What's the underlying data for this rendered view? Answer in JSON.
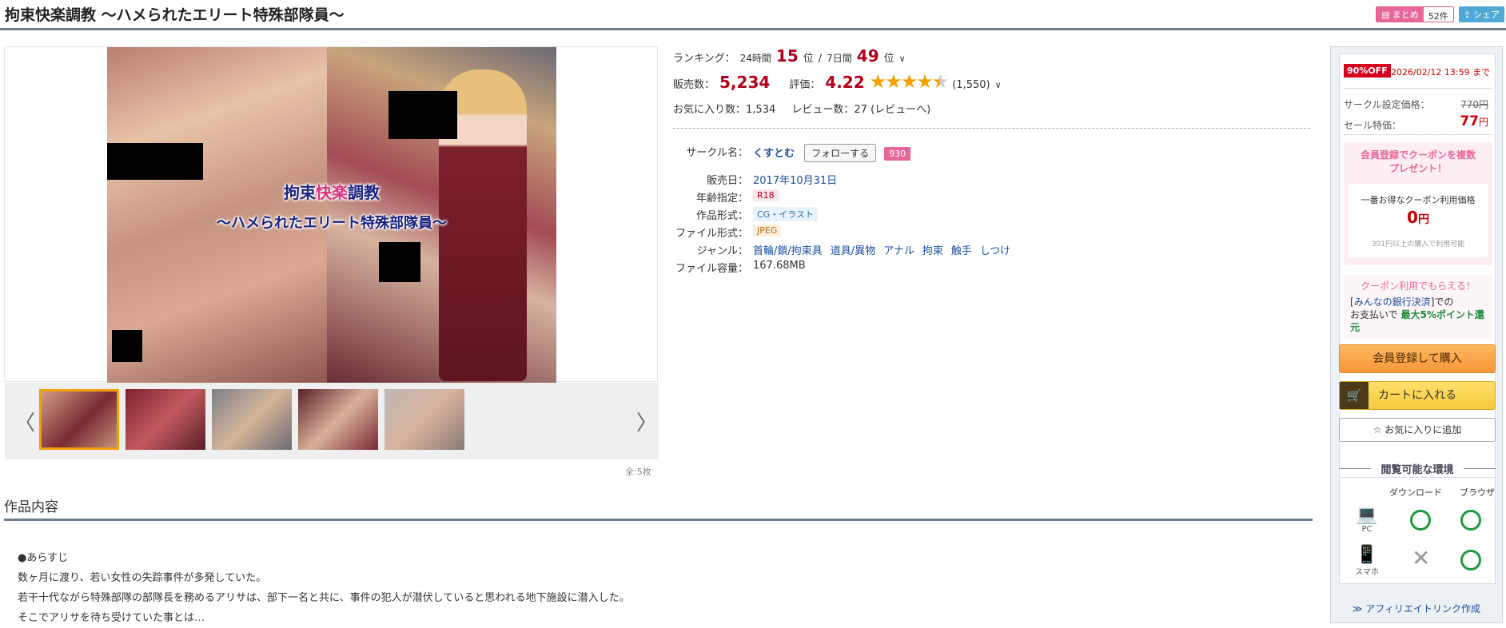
{
  "header": {
    "title": "拘束快楽調教 〜ハメられたエリート特殊部隊員〜",
    "matome_label": "まとめ",
    "matome_count": "52件",
    "share_label": "シェア"
  },
  "cover": {
    "title_line1_a": "拘束",
    "title_line1_b": "快楽",
    "title_line1_c": "調教",
    "title_line2": "〜ハメられたエリート特殊部隊員〜"
  },
  "gallery": {
    "total": "全:5枚"
  },
  "ranking": {
    "label": "ランキング：",
    "day_label": "24時間",
    "day_rank": "15",
    "unit": "位",
    "sep": "/",
    "week_label": "7日間",
    "week_rank": "49",
    "unit2": "位"
  },
  "sales": {
    "label": "販売数：",
    "value": "5,234",
    "rating_label": "評価：",
    "rating": "4.22",
    "stars_full": "★★★★",
    "stars_half": "★",
    "rating_count": "(1,550)",
    "fav_label": "お気に入り数：",
    "fav_value": "1,534",
    "review_label": "レビュー数：",
    "review_value": "27",
    "review_link": "(レビューへ)"
  },
  "specs": {
    "circle_key": "サークル名：",
    "circle": "くすとむ",
    "follow": "フォローする",
    "follow_count": "930",
    "date_key": "販売日：",
    "date": "2017年10月31日",
    "age_key": "年齢指定：",
    "age": "R18",
    "form_key": "作品形式：",
    "form": "CG・イラスト",
    "file_key": "ファイル形式：",
    "file": "JPEG",
    "genre_key": "ジャンル：",
    "genres": [
      "首輪/鎖/拘束具",
      "道具/異物",
      "アナル",
      "拘束",
      "触手",
      "しつけ"
    ],
    "size_key": "ファイル容量：",
    "size": "167.68MB"
  },
  "section": {
    "title": "作品内容",
    "lines": [
      "●あらすじ",
      "数ヶ月に渡り、若い女性の失踪事件が多発していた。",
      "若干十代ながら特殊部隊の部隊長を務めるアリサは、部下一名と共に、事件の犯人が潜伏していると思われる地下施設に潜入した。",
      "そこでアリサを待ち受けていた事とは…"
    ]
  },
  "buybox": {
    "off": "90%OFF",
    "sale_end": "2026/02/12 13:59 まで",
    "circle_price_label": "サークル設定価格：",
    "circle_price": "770円",
    "sale_label": "セール特価：",
    "sale_price": "77",
    "yen": "円",
    "coupon_title_1": "会員登録でクーポンを複数",
    "coupon_title_2": "プレゼント！",
    "coupon_best": "一番お得なクーポン利用価格",
    "coupon_price": "0",
    "coupon_yen": "円",
    "coupon_note": "301円以上の購入で利用可能",
    "bank_title": "クーポン利用でもらえる！",
    "bank_text_1": "[",
    "bank_link": "みんなの銀行決済",
    "bank_text_2": "]での",
    "bank_text_3": "お支払いで",
    "bank_bold": "最大5%ポイント還元",
    "member_btn": "会員登録して購入",
    "cart_btn": "カートに入れる",
    "fav_btn": "お気に入りに追加",
    "env_title": "閲覧可能な環境",
    "col_download": "ダウンロード",
    "col_browser": "ブラウザ",
    "pc": "PC",
    "phone": "スマホ",
    "affiliate": "≫ アフィリエイトリンク作成"
  }
}
